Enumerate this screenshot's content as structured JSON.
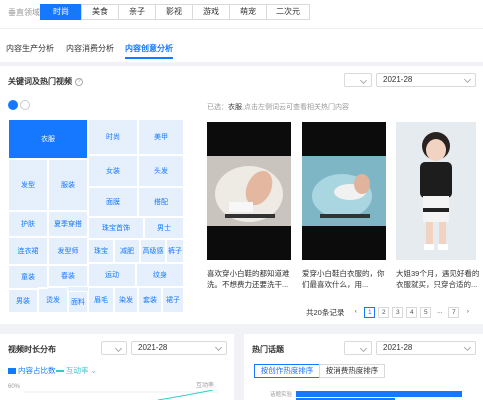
{
  "header": {
    "domain_label": "垂直领域",
    "domains": [
      "时尚",
      "美食",
      "亲子",
      "影视",
      "游戏",
      "萌宠",
      "二次元"
    ],
    "active_domain": "时尚"
  },
  "subtabs": [
    "内容生产分析",
    "内容消费分析",
    "内容创意分析"
  ],
  "active_subtab": "内容创意分析",
  "keywords_card": {
    "title": "关键词及热门视频",
    "date": "2021-28",
    "selected_prefix": "已选：",
    "selected_keyword": "衣服",
    "selected_hint": ",点击左侧词云可查看相关热门内容",
    "treemap": [
      {
        "label": "衣服",
        "big": true
      },
      {
        "label": "时尚"
      },
      {
        "label": "美甲"
      },
      {
        "label": "女装"
      },
      {
        "label": "头发"
      },
      {
        "label": "发型"
      },
      {
        "label": "服装"
      },
      {
        "label": "面膜"
      },
      {
        "label": "搭配"
      },
      {
        "label": "护肤"
      },
      {
        "label": "夏季穿搭"
      },
      {
        "label": "珠宝首饰"
      },
      {
        "label": "男士"
      },
      {
        "label": "连衣裙"
      },
      {
        "label": "发型师"
      },
      {
        "label": "珠宝"
      },
      {
        "label": "减肥"
      },
      {
        "label": "高级感"
      },
      {
        "label": "裤子"
      },
      {
        "label": "童装"
      },
      {
        "label": "春装"
      },
      {
        "label": "运动"
      },
      {
        "label": "纹身"
      },
      {
        "label": "烫发"
      },
      {
        "label": "眉毛"
      },
      {
        "label": "染发"
      },
      {
        "label": "套装"
      },
      {
        "label": "裙子"
      },
      {
        "label": "男装"
      },
      {
        "label": "面料"
      }
    ],
    "videos": [
      {
        "caption": "喜欢穿小白鞋的都知道难洗。不想费力还要洗干..."
      },
      {
        "caption": "爱穿小白鞋白衣服的，你们最喜欢什么，用..."
      },
      {
        "caption": "大姐39个月，遇见好看的衣服就买，只穿合适的..."
      }
    ],
    "pagination": {
      "total": "共20条记录",
      "prev": "‹",
      "pages": [
        "1",
        "2",
        "3",
        "4",
        "5",
        "...",
        "7"
      ],
      "next": "›",
      "active": "1"
    }
  },
  "duration_card": {
    "title": "视频时长分布",
    "date": "2021-28",
    "legend": [
      {
        "label": "内容占比数",
        "color": "#1677ff"
      },
      {
        "label": "互动率",
        "color": "#36cbcb"
      }
    ],
    "ytick": "60%",
    "right_label": "互动率"
  },
  "topics_card": {
    "title": "热门话题",
    "date": "2021-28",
    "buttons": [
      "按创作热度排序",
      "按消费热度排序"
    ],
    "active_button": "按创作热度排序",
    "bars": [
      {
        "label": "话题实验",
        "value": 0.92
      },
      {
        "label": "",
        "value": 0.55
      }
    ]
  },
  "colors": {
    "accent": "#1677ff",
    "accent_light": "#e6f0fd",
    "page_bg": "#f0f2f5"
  }
}
